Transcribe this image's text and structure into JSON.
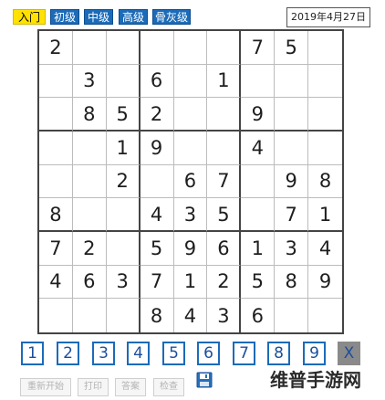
{
  "tabs": [
    {
      "label": "入门",
      "active": true
    },
    {
      "label": "初级",
      "active": false
    },
    {
      "label": "中级",
      "active": false
    },
    {
      "label": "高级",
      "active": false
    },
    {
      "label": "骨灰级",
      "active": false
    }
  ],
  "date": "2019年4月27日",
  "grid": [
    [
      "2",
      "",
      "",
      "",
      "",
      "",
      "7",
      "5",
      ""
    ],
    [
      "",
      "3",
      "",
      "6",
      "",
      "1",
      "",
      "",
      ""
    ],
    [
      "",
      "8",
      "5",
      "2",
      "",
      "",
      "9",
      "",
      ""
    ],
    [
      "",
      "",
      "1",
      "9",
      "",
      "",
      "4",
      "",
      ""
    ],
    [
      "",
      "",
      "2",
      "",
      "6",
      "7",
      "",
      "9",
      "8"
    ],
    [
      "8",
      "",
      "",
      "4",
      "3",
      "5",
      "",
      "7",
      "1"
    ],
    [
      "7",
      "2",
      "",
      "5",
      "9",
      "6",
      "1",
      "3",
      "4"
    ],
    [
      "4",
      "6",
      "3",
      "7",
      "1",
      "2",
      "5",
      "8",
      "9"
    ],
    [
      "",
      "",
      "",
      "8",
      "4",
      "3",
      "6",
      "",
      ""
    ]
  ],
  "keypad": {
    "digits": [
      "1",
      "2",
      "3",
      "4",
      "5",
      "6",
      "7",
      "8",
      "9"
    ],
    "erase_label": "X"
  },
  "actions": {
    "restart_label": "重新开始",
    "print_label": "打印",
    "answer_label": "答案",
    "check_label": "检查"
  },
  "watermark": "维普手游网",
  "colors": {
    "tab_blue": "#1b6bb8",
    "tab_active_yellow": "#ffe200",
    "key_border_blue": "#1b6bb8",
    "erase_gray": "#8a8a8a"
  }
}
